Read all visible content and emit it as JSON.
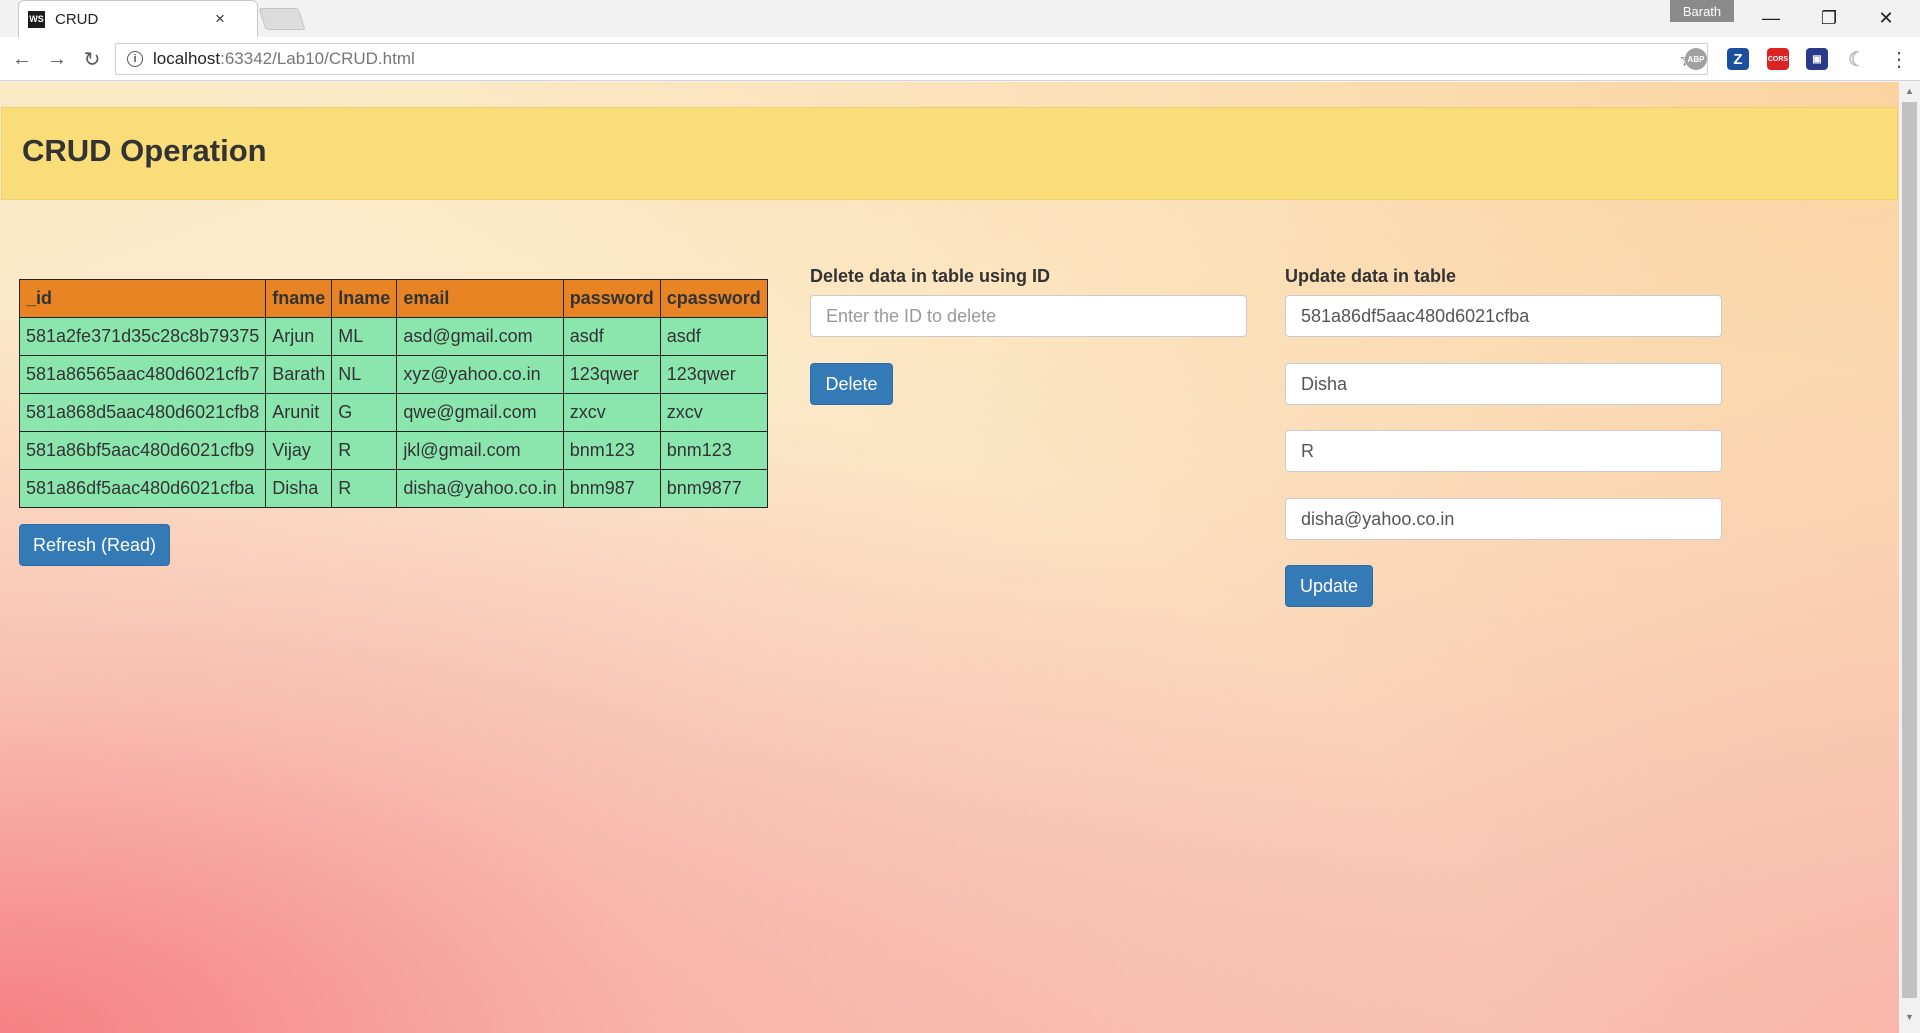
{
  "browser": {
    "tab_title": "CRUD",
    "tab_favicon": "WS",
    "profile_name": "Barath",
    "url_host": "localhost",
    "url_path": ":63342/Lab10/CRUD.html",
    "extensions": [
      "ABP",
      "Z",
      "CORS",
      "doc-icon",
      "moon-icon"
    ]
  },
  "page": {
    "title": "CRUD Operation",
    "table": {
      "columns": [
        "_id",
        "fname",
        "lname",
        "email",
        "password",
        "cpassword"
      ],
      "rows": [
        [
          "581a2fe371d35c28c8b79375",
          "Arjun",
          "ML",
          "asd@gmail.com",
          "asdf",
          "asdf"
        ],
        [
          "581a86565aac480d6021cfb7",
          "Barath",
          "NL",
          "xyz@yahoo.co.in",
          "123qwer",
          "123qwer"
        ],
        [
          "581a868d5aac480d6021cfb8",
          "Arunit",
          "G",
          "qwe@gmail.com",
          "zxcv",
          "zxcv"
        ],
        [
          "581a86bf5aac480d6021cfb9",
          "Vijay",
          "R",
          "jkl@gmail.com",
          "bnm123",
          "bnm123"
        ],
        [
          "581a86df5aac480d6021cfba",
          "Disha",
          "R",
          "disha@yahoo.co.in",
          "bnm987",
          "bnm9877"
        ]
      ]
    },
    "refresh_label": "Refresh (Read)",
    "delete": {
      "heading": "Delete data in table using ID",
      "placeholder": "Enter the ID to delete",
      "button_label": "Delete"
    },
    "update": {
      "heading": "Update data in table",
      "id_value": "581a86df5aac480d6021cfba",
      "fname_value": "Disha",
      "lname_value": "R",
      "email_value": "disha@yahoo.co.in",
      "button_label": "Update"
    }
  },
  "colors": {
    "header_bg": "#f8dd78",
    "table_header_bg": "#e88424",
    "table_cell_bg": "#8be6ae",
    "button_bg": "#337ab7"
  }
}
